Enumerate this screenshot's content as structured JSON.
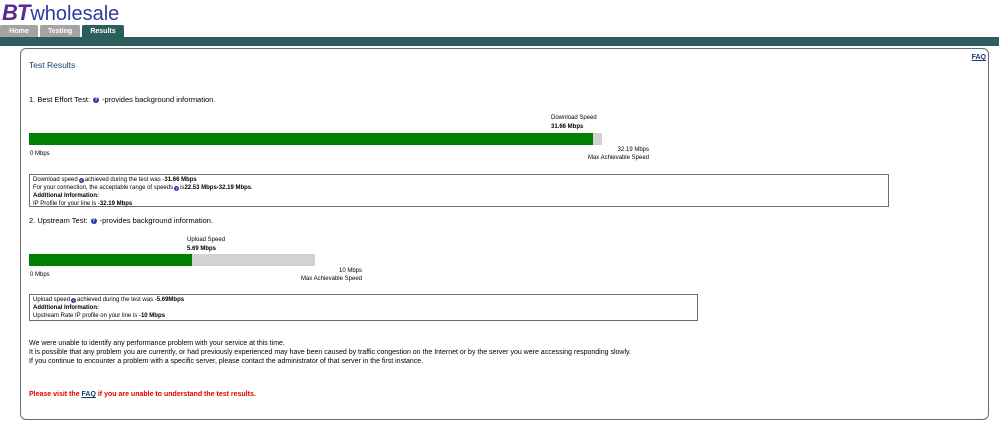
{
  "brand": {
    "logo_bt": "BT",
    "logo_rest": "wholesale"
  },
  "nav": {
    "tabs": [
      {
        "label": "Home"
      },
      {
        "label": "Testing"
      },
      {
        "label": "Results"
      }
    ],
    "active_tab": "Results"
  },
  "faq_top": "FAQ",
  "title": "Test Results",
  "best_effort": {
    "heading_prefix": "1. Best Effort Test:",
    "heading_suffix": "-provides background information.",
    "speed_caption": "Download Speed",
    "speed_value": "31.66 Mbps",
    "min_label": "0 Mbps",
    "max_value": "32.19 Mbps",
    "max_caption": "Max Achievable Speed",
    "measured_mbps": 31.66,
    "max_mbps": 32.19,
    "info": {
      "line1_a": "Download speed",
      "line1_b": "achieved during the test was - ",
      "line1_val": "31.66 Mbps",
      "line2_a": "For your connection, the acceptable range of speeds",
      "line2_b": "is ",
      "line2_val": "22.53 Mbps-32.19 Mbps",
      "line2_end": " .",
      "line3": "Additional Information:",
      "line4_a": "IP Profile for your line is - ",
      "line4_val": "32.19 Mbps"
    }
  },
  "upstream": {
    "heading_prefix": "2. Upstream Test:",
    "heading_suffix": "-provides background information.",
    "speed_caption": "Upload Speed",
    "speed_value": "5.69 Mbps",
    "min_label": "0 Mbps",
    "max_value": "10 Mbps",
    "max_caption": "Max Achievable Speed",
    "measured_mbps": 5.69,
    "max_mbps": 10,
    "info": {
      "line1_a": "Upload speed",
      "line1_b": " achieved during the test was - ",
      "line1_val": "5.69Mbps",
      "line2": "Additional Information:",
      "line3_a": "Upstream Rate IP profile on your line is - ",
      "line3_val": "10 Mbps"
    }
  },
  "messages": [
    "We were unable to identify any performance problem with your service at this time.",
    "It is possible that any problem you are currently, or had previously experienced may have been caused by traffic congestion on the Internet or by the server you were accessing responding slowly.",
    "If you continue to encounter a problem with a specific server, please contact the administrator of that server in the first instance."
  ],
  "footer_note": {
    "prefix": "Please visit the ",
    "link": "FAQ",
    "suffix": " if you are unable to understand the test results."
  },
  "colors": {
    "brand_teal": "#2d5e5e",
    "fill_green": "#008000",
    "track_grey": "#d2d2d2",
    "warning_red": "#e00000"
  }
}
